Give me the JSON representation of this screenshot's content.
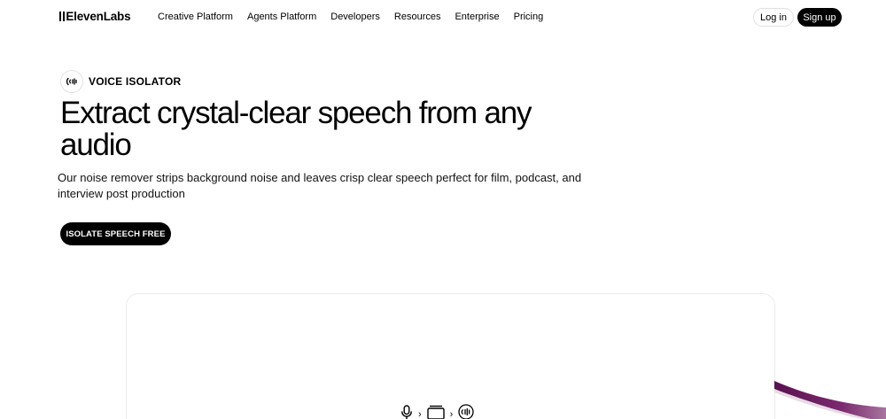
{
  "nav": {
    "logo": "ElevenLabs",
    "links": [
      "Creative Platform",
      "Agents Platform",
      "Developers",
      "Resources",
      "Enterprise",
      "Pricing"
    ],
    "login_label": "Log in",
    "signup_label": "Sign up"
  },
  "hero": {
    "badge_icon": "sound-wave-icon",
    "badge_label": "VOICE ISOLATOR",
    "title": "Extract crystal-clear speech from any audio",
    "subtitle": "Our noise remover strips background noise and leaves crisp clear speech perfect for film, podcast, and interview post production",
    "cta_label": "ISOLATE SPEECH FREE"
  },
  "demo": {
    "flow_icons": [
      "microphone-icon",
      "chevron-right-icon",
      "window-icon",
      "chevron-right-icon",
      "sound-wave-icon"
    ]
  },
  "colors": {
    "primary": "#000000",
    "background": "#ffffff",
    "accent_swoosh": "#6b1a5e"
  }
}
